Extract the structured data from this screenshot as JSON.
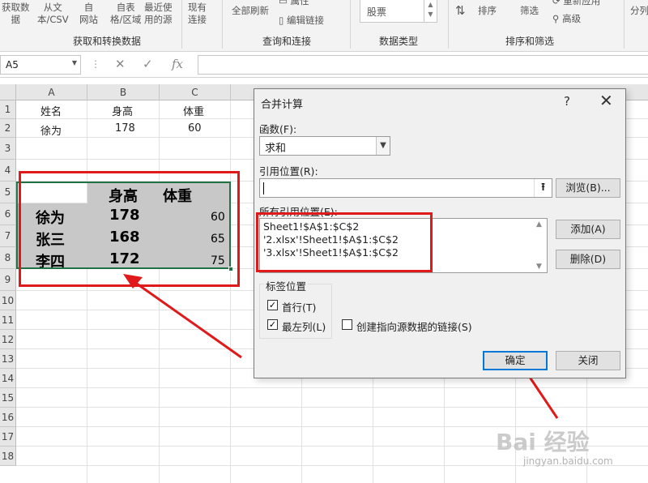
{
  "ribbon": {
    "get_data": "获取数\n据",
    "from_text_csv": "从文\n本/CSV",
    "from_web": "自\n网站",
    "from_table": "自表\n格/区域",
    "recent_sources": "最近使\n用的源",
    "existing_conn": "现有\n连接",
    "refresh_all": "全部刷新",
    "properties": "属性",
    "edit_links": "编辑链接",
    "stock": "股票",
    "sort": "排序",
    "filter": "筛选",
    "reapply": "重新应用",
    "advanced": "高级",
    "split": "分列",
    "group_get_transform": "获取和转换数据",
    "group_queries": "查询和连接",
    "group_data_types": "数据类型",
    "group_sort_filter": "排序和筛选"
  },
  "formula_bar": {
    "name_box": "A5",
    "cancel": "✕",
    "enter": "✓",
    "fx": "fx",
    "formula": ""
  },
  "sheet": {
    "columns": [
      "A",
      "B",
      "C"
    ],
    "rows": [
      "1",
      "2",
      "3",
      "4",
      "5",
      "6",
      "7",
      "8",
      "9",
      "10",
      "11",
      "12",
      "13",
      "14",
      "15",
      "16",
      "17",
      "18"
    ],
    "r1": [
      "姓名",
      "身高",
      "体重"
    ],
    "r2": [
      "徐为",
      "178",
      "60"
    ],
    "r5": [
      "身高",
      "体重"
    ],
    "r6": [
      "徐为",
      "178",
      "60"
    ],
    "r7": [
      "张三",
      "168",
      "65"
    ],
    "r8": [
      "李四",
      "172",
      "75"
    ]
  },
  "dialog": {
    "title": "合并计算",
    "help": "?",
    "close": "✕",
    "function_label": "函数(F):",
    "function_value": "求和",
    "reference_label": "引用位置(R):",
    "reference_value": "",
    "browse": "浏览(B)...",
    "all_refs_label": "所有引用位置(E):",
    "refs": [
      "Sheet1!$A$1:$C$2",
      "'2.xlsx'!Sheet1!$A$1:$C$2",
      "'3.xlsx'!Sheet1!$A$1:$C$2"
    ],
    "add": "添加(A)",
    "delete": "删除(D)",
    "labels_group": "标签位置",
    "top_row": "首行(T)",
    "left_column": "最左列(L)",
    "create_links": "创建指向源数据的链接(S)",
    "ok": "确定",
    "close_btn": "关闭"
  },
  "watermark": {
    "brand": "Bai 经验",
    "url": "jingyan.baidu.com"
  },
  "colors": {
    "accent_red": "#e01a1a",
    "excel_green": "#217346",
    "ok_focus": "#0078d7"
  }
}
